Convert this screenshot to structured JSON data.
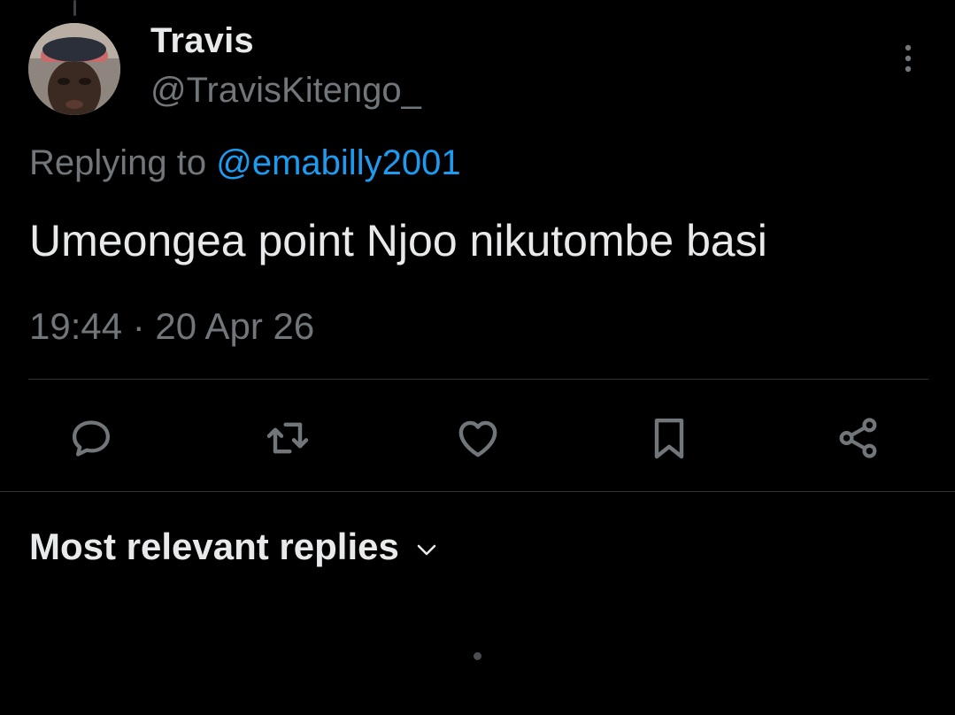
{
  "tweet": {
    "author": {
      "display_name": "Travis",
      "handle": "@TravisKitengo_"
    },
    "replying_to": {
      "prefix": "Replying to",
      "mention": "@emabilly2001"
    },
    "text": "Umeongea point Njoo nikutombe basi",
    "timestamp": "19:44 · 20 Apr 26"
  },
  "actions": [
    {
      "icon": "reply-icon"
    },
    {
      "icon": "retweet-icon"
    },
    {
      "icon": "like-icon"
    },
    {
      "icon": "bookmark-icon"
    },
    {
      "icon": "share-icon"
    }
  ],
  "replies": {
    "sort_label": "Most relevant replies",
    "sort_icon": "chevron-down-icon"
  },
  "colors": {
    "background": "#000000",
    "primary_text": "#e7e9ea",
    "secondary_text": "#71767b",
    "accent": "#1d9bf0",
    "divider": "#2f3336"
  }
}
